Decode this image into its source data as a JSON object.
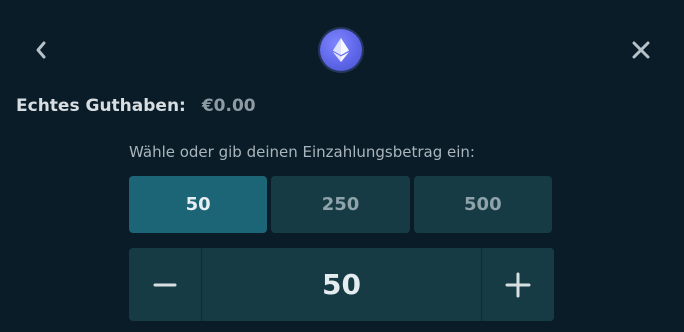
{
  "header": {
    "back_icon": "chevron-left-icon",
    "coin_icon": "ethereum-icon",
    "close_icon": "close-icon"
  },
  "balance": {
    "label": "Echtes Guthaben:",
    "value": "€0.00"
  },
  "deposit": {
    "prompt": "Wähle oder gib deinen Einzahlungsbetrag ein:",
    "presets": [
      "50",
      "250",
      "500"
    ],
    "selected_preset": "50",
    "amount": "50",
    "minus_icon": "minus-icon",
    "plus_icon": "plus-icon"
  },
  "colors": {
    "background": "#0a1c27",
    "preset_active": "#1c6577",
    "preset_inactive": "#173b45",
    "coin": "#6a72f0"
  }
}
